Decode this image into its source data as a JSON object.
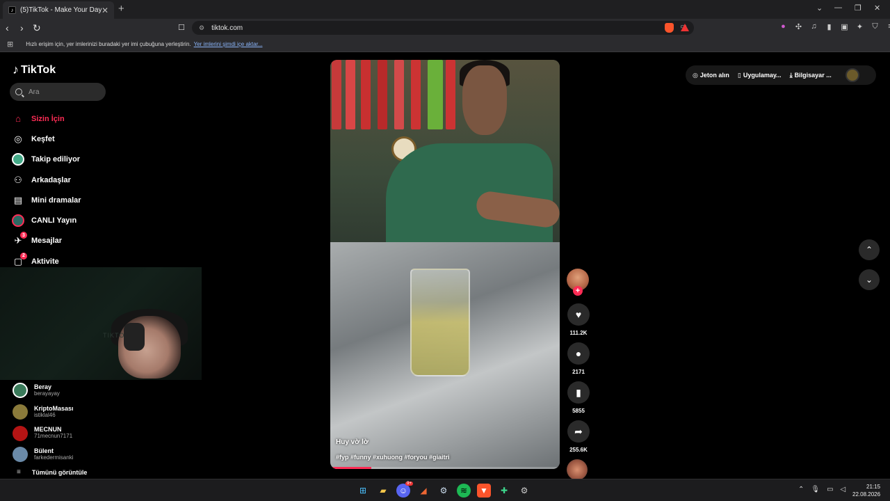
{
  "browser": {
    "tab_title": "(5)TikTok - Make Your Day",
    "new_tab_glyph": "+",
    "url": "tiktok.com",
    "bookmark_hint": "Hızlı erişim için, yer imlerinizi buradaki yer imi çubuğuna yerleştirin.",
    "bookmark_link": "Yer imlerini şimdi içe aktar...",
    "extension_icons": [
      "brave-rewards-icon",
      "puzzle-icon",
      "music-icon",
      "sidebar-icon",
      "wallet-icon",
      "shield-icon",
      "menu-icon"
    ]
  },
  "sidebar": {
    "logo": "TikTok",
    "search_placeholder": "Ara",
    "items": [
      {
        "label": "Sizin İçin",
        "icon": "home-icon",
        "active": true
      },
      {
        "label": "Keşfet",
        "icon": "compass-icon"
      },
      {
        "label": "Takip ediliyor",
        "icon": "following-avatar-icon"
      },
      {
        "label": "Arkadaşlar",
        "icon": "friends-icon"
      },
      {
        "label": "Mini dramalar",
        "icon": "film-icon"
      },
      {
        "label": "CANLI Yayın",
        "icon": "live-icon"
      },
      {
        "label": "Mesajlar",
        "icon": "messages-icon",
        "badge": "3"
      },
      {
        "label": "Aktivite",
        "icon": "activity-icon",
        "badge": "2"
      }
    ],
    "following": [
      {
        "name": "Beray",
        "handle": "berayayay",
        "color": "#ffffff"
      },
      {
        "name": "KriptoMasası",
        "handle": "istiklal46",
        "color": "#8a7a3a"
      },
      {
        "name": "MECNUN",
        "handle": "71mecnun7171",
        "color": "#b41414"
      },
      {
        "name": "Bülent",
        "handle": "farkedermisanki",
        "color": "#6a8aa8"
      }
    ],
    "see_all": "Tümünü görüntüle"
  },
  "webcam": {
    "watermark": "TIKTO"
  },
  "video": {
    "caption": "Huy vờ lờ",
    "hashtags": "#fyp #funny #xuhuong #foryou #giaitri",
    "progress": 0.18
  },
  "actions": {
    "likes": "111.2K",
    "comments": "2171",
    "saves": "5855",
    "shares": "255.6K"
  },
  "topbar": {
    "coins": "Jeton alın",
    "app": "Uygulamay...",
    "desktop": "Bilgisayar ..."
  },
  "taskbar": {
    "time": "21:15",
    "date": "22.08.2026",
    "discord_badge": "9+"
  },
  "colors": {
    "accent": "#fe2c55",
    "background": "#000000"
  }
}
